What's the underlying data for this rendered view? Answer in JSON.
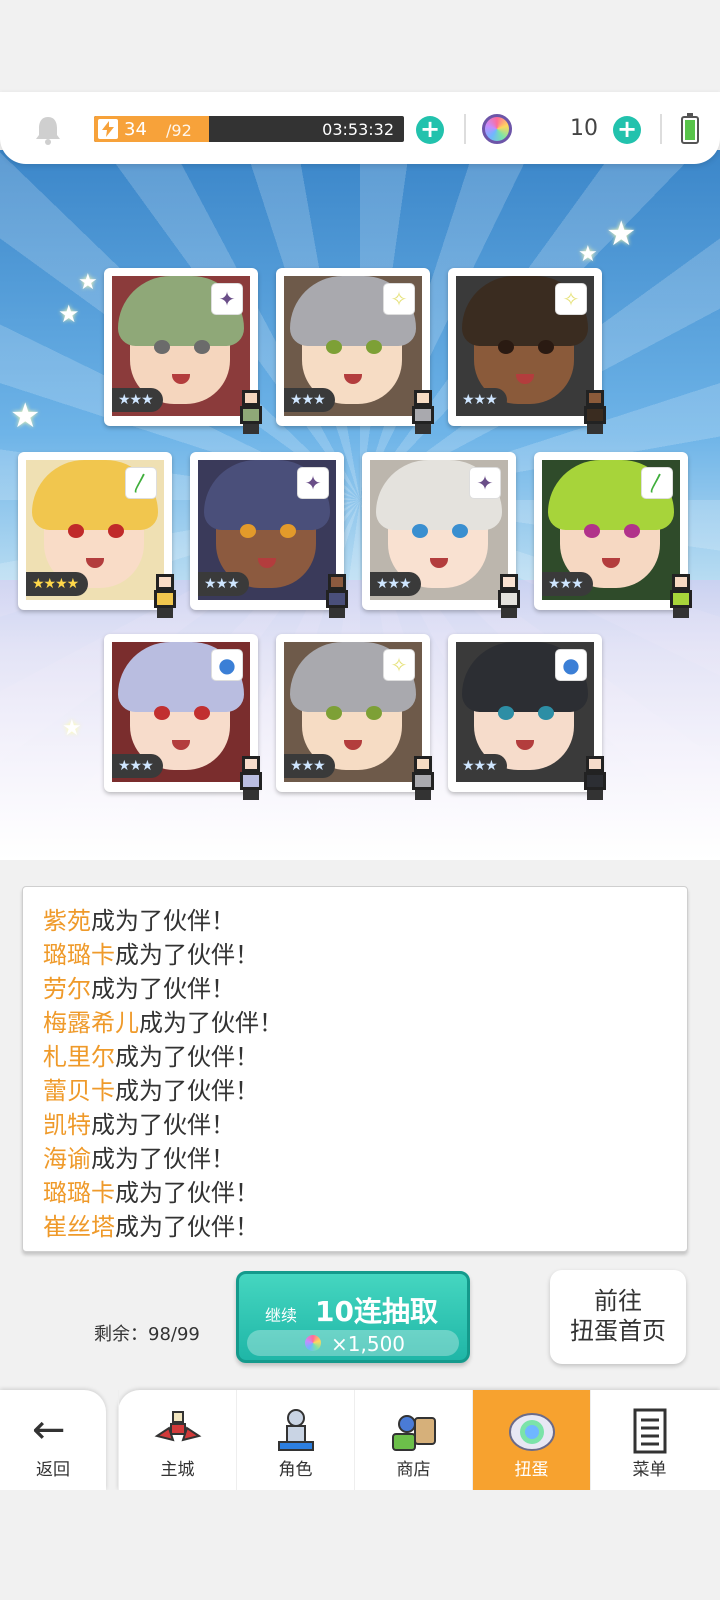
{
  "status_bar": {
    "stamina_current": "34",
    "stamina_max": "/92",
    "stamina_fraction": 0.37,
    "stamina_timer": "03:53:32",
    "gem_count": "10"
  },
  "cards": [
    {
      "stars": "★★★",
      "badge_icon": "dark-element-icon",
      "badge_glyph": "✦",
      "badge_color": "#6a4e88",
      "hair": "#8fa878",
      "skin": "#f5d6be",
      "eye": "#6b6b6b",
      "bg": "#8b3b3b"
    },
    {
      "stars": "★★★",
      "badge_icon": "light-element-icon",
      "badge_glyph": "✧",
      "badge_color": "#e6e27a",
      "hair": "#a9a9ae",
      "skin": "#f6dcc4",
      "eye": "#7da036",
      "bg": "#6e5a4a"
    },
    {
      "stars": "★★★",
      "badge_icon": "light-element-icon",
      "badge_glyph": "✧",
      "badge_color": "#e6e27a",
      "hair": "#3a2c20",
      "skin": "#8a5a3a",
      "eye": "#2a1a12",
      "bg": "#3a3a3a"
    },
    {
      "stars": "★★★★",
      "gold": true,
      "badge_icon": "wind-element-icon",
      "badge_glyph": "〳",
      "badge_color": "#3fae3b",
      "hair": "#f1c64e",
      "skin": "#f9dcc7",
      "eye": "#c02a2a",
      "bg": "#efe0b3"
    },
    {
      "stars": "★★★",
      "badge_icon": "dark-element-icon",
      "badge_glyph": "✦",
      "badge_color": "#6a4e88",
      "hair": "#4a4f7a",
      "skin": "#8c5a3f",
      "eye": "#e39a2a",
      "bg": "#3a3a5a"
    },
    {
      "stars": "★★★",
      "badge_icon": "dark-element-icon",
      "badge_glyph": "✦",
      "badge_color": "#6a4e88",
      "hair": "#e4e2dd",
      "skin": "#f9e1d1",
      "eye": "#3a8fd0",
      "bg": "#bcb6ad"
    },
    {
      "stars": "★★★",
      "badge_icon": "wind-element-icon",
      "badge_glyph": "〳",
      "badge_color": "#3fae3b",
      "hair": "#a7d43a",
      "skin": "#f6d8c2",
      "eye": "#b1338a",
      "bg": "#2f4b2a"
    },
    {
      "stars": "★★★",
      "badge_icon": "water-element-icon",
      "badge_glyph": "●",
      "badge_color": "#3b7fd6",
      "hair": "#b9bde0",
      "skin": "#f7dccb",
      "eye": "#c13030",
      "bg": "#7a2d2d"
    },
    {
      "stars": "★★★",
      "badge_icon": "light-element-icon",
      "badge_glyph": "✧",
      "badge_color": "#e6e27a",
      "hair": "#a9a9ae",
      "skin": "#f6dcc4",
      "eye": "#7da036",
      "bg": "#6e5a4a"
    },
    {
      "stars": "★★★",
      "badge_icon": "water-element-icon",
      "badge_glyph": "●",
      "badge_color": "#3b7fd6",
      "hair": "#2c2e33",
      "skin": "#f6dccb",
      "eye": "#2d8ea5",
      "bg": "#3a3a3a"
    }
  ],
  "log": {
    "suffix": "成为了伙伴！",
    "names": [
      "紫苑",
      "璐璐卡",
      "劳尔",
      "梅露希儿",
      "札里尔",
      "蕾贝卡",
      "凯特",
      "海谕",
      "璐璐卡",
      "崔丝塔"
    ]
  },
  "pull": {
    "remaining": "剩余：98/99",
    "continue_label": "继续",
    "title": "10连抽取",
    "cost": "×1,500"
  },
  "home_button": {
    "line1": "前往",
    "line2": "扭蛋首页"
  },
  "nav": {
    "back": "返回",
    "tabs": [
      {
        "label": "主城",
        "icon": "castle-icon"
      },
      {
        "label": "角色",
        "icon": "character-icon"
      },
      {
        "label": "商店",
        "icon": "shop-icon"
      },
      {
        "label": "扭蛋",
        "icon": "gacha-icon",
        "active": true
      },
      {
        "label": "菜单",
        "icon": "menu-icon"
      }
    ]
  },
  "colors": {
    "accent_orange": "#f7a22f",
    "accent_teal": "#22c2ad",
    "log_name": "#ef9a2a"
  }
}
